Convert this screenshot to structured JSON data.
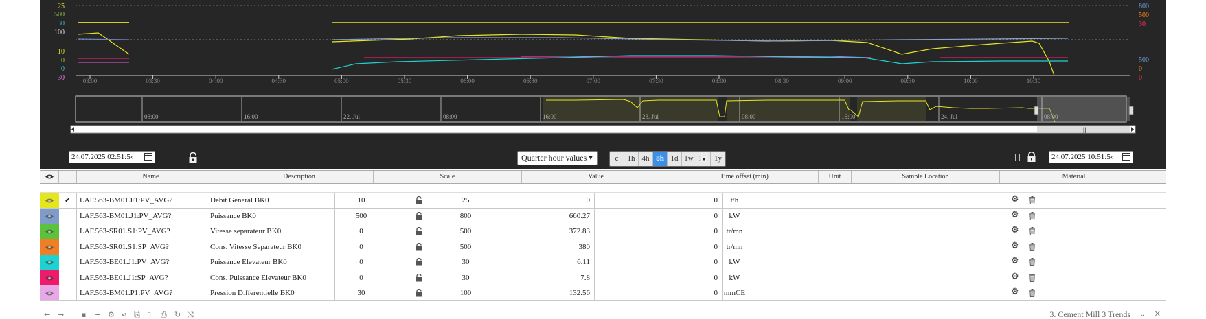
{
  "chart": {
    "left_axis_labels": [
      {
        "text": "25",
        "color": "#e6e62e"
      },
      {
        "text": "500",
        "color": "#9ac94a"
      },
      {
        "text": "30",
        "color": "#36c8d8"
      },
      {
        "text": "100",
        "color": "#f2e6f2"
      },
      {
        "text": "10",
        "color": "#e6e62e"
      },
      {
        "text": "0",
        "color": "#9ac94a"
      },
      {
        "text": "0",
        "color": "#36c8d8"
      },
      {
        "text": "30",
        "color": "#ff80ff"
      }
    ],
    "right_axis_labels": [
      {
        "text": "800",
        "color": "#6ea0e0"
      },
      {
        "text": "500",
        "color": "#ff8c1a"
      },
      {
        "text": "30",
        "color": "#ff3060"
      },
      {
        "text": "500",
        "color": "#6ea0e0"
      },
      {
        "text": "0",
        "color": "#ff8c1a"
      },
      {
        "text": "0",
        "color": "#ff3060"
      }
    ],
    "time_ticks": [
      "03:00",
      "03:30",
      "04:00",
      "04:30",
      "05:00",
      "05:30",
      "06:00",
      "06:30",
      "07:00",
      "07:30",
      "08:00",
      "08:30",
      "09:00",
      "09:30",
      "10:00",
      "10:30"
    ],
    "navigator_ticks": [
      "08:00",
      "16:00",
      "22. Jul",
      "08:00",
      "16:00",
      "23. Jul",
      "08:00",
      "16:00",
      "24. Jul",
      "08:00"
    ]
  },
  "controls": {
    "start_date": "24.07.2025 02:51:5‹",
    "end_date": "24.07.2025 10:51:5‹",
    "interval": "Quarter hour values",
    "ranges": [
      "c",
      "1h",
      "4h",
      "8h",
      "1d",
      "1w",
      "1m",
      "1y"
    ],
    "active_range": "8h"
  },
  "table": {
    "headers": [
      "Name",
      "Description",
      "Scale",
      "Value",
      "Time offset (min)",
      "Unit",
      "Sample Location",
      "Material"
    ],
    "rows": [
      {
        "color": "#e6e620",
        "checked": "✔",
        "name": "LAF.563-BM01.F1:PV_AVG?",
        "description": "Debit General BK0",
        "scale_min": "10",
        "scale_max": "25",
        "value": "0",
        "offset": "0",
        "unit": "t/h"
      },
      {
        "color": "#7d9cc8",
        "checked": "",
        "name": "LAF.563-BM01.J1:PV_AVG?",
        "description": "Puissance BK0",
        "scale_min": "500",
        "scale_max": "800",
        "value": "660.27",
        "offset": "0",
        "unit": "kW"
      },
      {
        "color": "#5cc23c",
        "checked": "",
        "name": "LAF.563-SR01.S1:PV_AVG?",
        "description": "Vitesse separateur BK0",
        "scale_min": "0",
        "scale_max": "500",
        "value": "372.83",
        "offset": "0",
        "unit": "tr/mn"
      },
      {
        "color": "#ef7f27",
        "checked": "",
        "name": "LAF.563-SR01.S1:SP_AVG?",
        "description": "Cons. Vitesse Separateur BK0",
        "scale_min": "0",
        "scale_max": "500",
        "value": "380",
        "offset": "0",
        "unit": "tr/mn"
      },
      {
        "color": "#1fd2d2",
        "checked": "",
        "name": "LAF.563-BE01.J1:PV_AVG?",
        "description": "Puissance Elevateur BK0",
        "scale_min": "0",
        "scale_max": "30",
        "value": "6.11",
        "offset": "0",
        "unit": "kW"
      },
      {
        "color": "#ee1a6a",
        "checked": "",
        "name": "LAF.563-BE01.J1:SP_AVG?",
        "description": "Cons. Puissance Elevateur BK0",
        "scale_min": "0",
        "scale_max": "30",
        "value": "7.8",
        "offset": "0",
        "unit": "kW"
      },
      {
        "color": "#e8a8e8",
        "checked": "",
        "name": "LAF.563-BM01.P1:PV_AVG?",
        "description": "Pression Differentielle BK0",
        "scale_min": "30",
        "scale_max": "100",
        "value": "132.56",
        "offset": "0",
        "unit": "mmCE"
      }
    ]
  },
  "footer": {
    "title": "3. Cement Mill 3 Trends"
  }
}
